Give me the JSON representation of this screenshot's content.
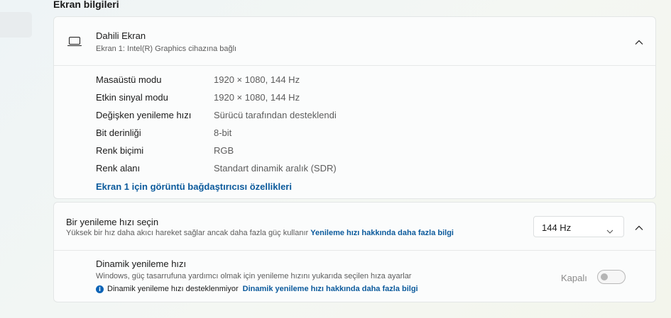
{
  "section": {
    "title": "Ekran bilgileri"
  },
  "display": {
    "icon": "laptop-icon",
    "title": "Dahili Ekran",
    "subtitle": "Ekran 1: Intel(R) Graphics cihazına bağlı",
    "details": [
      {
        "label": "Masaüstü modu",
        "value": "1920 × 1080, 144 Hz"
      },
      {
        "label": "Etkin sinyal modu",
        "value": "1920 × 1080, 144 Hz"
      },
      {
        "label": "Değişken yenileme hızı",
        "value": "Sürücü tarafından desteklendi"
      },
      {
        "label": "Bit derinliği",
        "value": "8-bit"
      },
      {
        "label": "Renk biçimi",
        "value": "RGB"
      },
      {
        "label": "Renk alanı",
        "value": "Standart dinamik aralık (SDR)"
      }
    ],
    "adapter_link": "Ekran 1 için görüntü bağdaştırıcısı özellikleri"
  },
  "refresh": {
    "title": "Bir yenileme hızı seçin",
    "subtitle": "Yüksek bir hız daha akıcı hareket sağlar ancak daha fazla güç kullanır",
    "subtitle_link": "Yenileme hızı hakkında daha fazla bilgi",
    "selected": "144 Hz",
    "dynamic": {
      "title": "Dinamik yenileme hızı",
      "subtitle": "Windows, güç tasarrufuna yardımcı olmak için yenileme hızını yukarıda seçilen hıza ayarlar",
      "info_text": "Dinamik yenileme hızı desteklenmiyor",
      "info_link": "Dinamik yenileme hızı hakkında daha fazla bilgi",
      "toggle_label": "Kapalı",
      "toggle_on": false
    }
  },
  "colors": {
    "link": "#0b5a9c",
    "info": "#0b63b6"
  }
}
